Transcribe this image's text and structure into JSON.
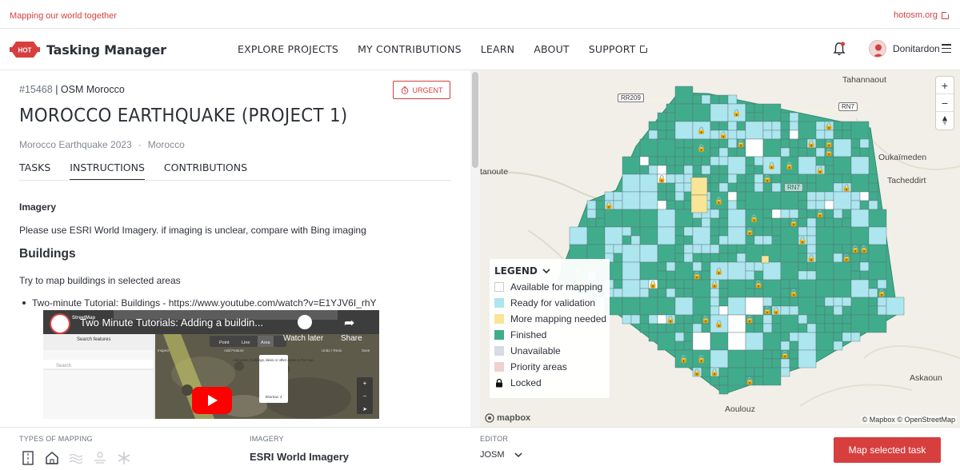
{
  "topbar": {
    "tagline": "Mapping our world together",
    "site_link": "hotosm.org"
  },
  "nav": {
    "brand": "Tasking Manager",
    "logo_text": "HOT",
    "menu": [
      {
        "label": "EXPLORE PROJECTS"
      },
      {
        "label": "MY CONTRIBUTIONS"
      },
      {
        "label": "LEARN"
      },
      {
        "label": "ABOUT"
      },
      {
        "label": "SUPPORT"
      }
    ],
    "username": "Donitardon"
  },
  "project": {
    "id": "#15468",
    "org": "| OSM Morocco",
    "urgent_label": "URGENT",
    "title": "MOROCCO EARTHQUAKE (PROJECT 1)",
    "campaign": "Morocco Earthquake 2023",
    "separator": "·",
    "country": "Morocco",
    "tabs": [
      {
        "label": "TASKS"
      },
      {
        "label": "INSTRUCTIONS"
      },
      {
        "label": "CONTRIBUTIONS"
      }
    ]
  },
  "instructions": {
    "imagery_heading": "Imagery",
    "imagery_text": "Please use ESRI World Imagery. if imaging is unclear, compare with Bing imaging",
    "buildings_heading": "Buildings",
    "buildings_text": "Try to map buildings in selected areas",
    "tutorial_item": "Two-minute Tutorial: Buildings - https://www.youtube.com/watch?v=E1YJV6I_rhY",
    "video": {
      "title": "Two Minute Tutorials: Adding a buildin...",
      "watch_later": "Watch later",
      "share": "Share",
      "brand": "StreetMap",
      "search_features": "Search features",
      "search": "Search",
      "toolbar": [
        "Point",
        "Line",
        "Area"
      ],
      "toolbar_captions": [
        "Inspect",
        "Add Feature",
        "Undo / Redo",
        "Save"
      ],
      "tooltip": "Add parks, buildings, lakes or other areas to the map.",
      "shortcut": "Shortcut: 3"
    }
  },
  "map": {
    "places": [
      "Tahannaout",
      "Oukaïmeden",
      "Tacheddirt",
      "tanoute",
      "Askaoun",
      "Aoulouz"
    ],
    "roads": [
      "RR209",
      "RN7",
      "RN7"
    ],
    "attribution": "© Mapbox © OpenStreetMap",
    "mapbox": "mapbox",
    "legend": {
      "title": "LEGEND",
      "items": [
        {
          "label": "Available for mapping",
          "color": "#ffffff"
        },
        {
          "label": "Ready for validation",
          "color": "#ade6ef"
        },
        {
          "label": "More mapping needed",
          "color": "#f8e595"
        },
        {
          "label": "Finished",
          "color": "#40ac8c"
        },
        {
          "label": "Unavailable",
          "color": "#d8dae4"
        },
        {
          "label": "Priority areas",
          "color": "#efd1d1"
        },
        {
          "label": "Locked",
          "icon": "lock-icon"
        }
      ]
    },
    "zoom_in": "+",
    "zoom_out": "−"
  },
  "footer": {
    "types_label": "TYPES OF MAPPING",
    "imagery_label": "IMAGERY",
    "imagery_value": "ESRI World Imagery",
    "editor_label": "EDITOR",
    "editor_value": "JOSM",
    "map_button": "Map selected task",
    "mapping_types": [
      "roads-icon",
      "buildings-icon",
      "waterways-icon",
      "landuse-icon",
      "other-icon"
    ]
  },
  "colors": {
    "accent": "#d73f3f",
    "finished": "#40ac8c",
    "validation": "#ade6ef",
    "mapping_needed": "#f8e595"
  }
}
